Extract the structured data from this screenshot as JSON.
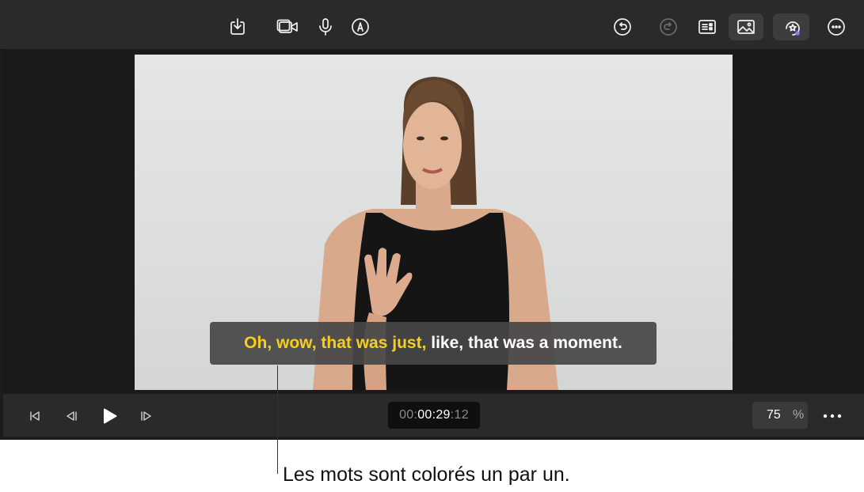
{
  "toolbar": {
    "left_icons": [
      "import-icon",
      "camera-icon",
      "microphone-icon",
      "markup-icon"
    ],
    "right_icons": [
      "undo-icon",
      "redo-icon",
      "inspector-icon",
      "photo-icon",
      "title-effects-icon",
      "more-icon"
    ]
  },
  "caption": {
    "highlighted": "Oh, wow, that was just,",
    "rest": " like, that was a moment.",
    "highlight_color": "#f6cf1e"
  },
  "transport": {
    "timecode_prefix": "00:",
    "timecode_main": "00:29",
    "timecode_suffix": ":12",
    "zoom_value": "75",
    "zoom_unit": "%"
  },
  "callout": {
    "text": "Les mots sont colorés un par un."
  }
}
